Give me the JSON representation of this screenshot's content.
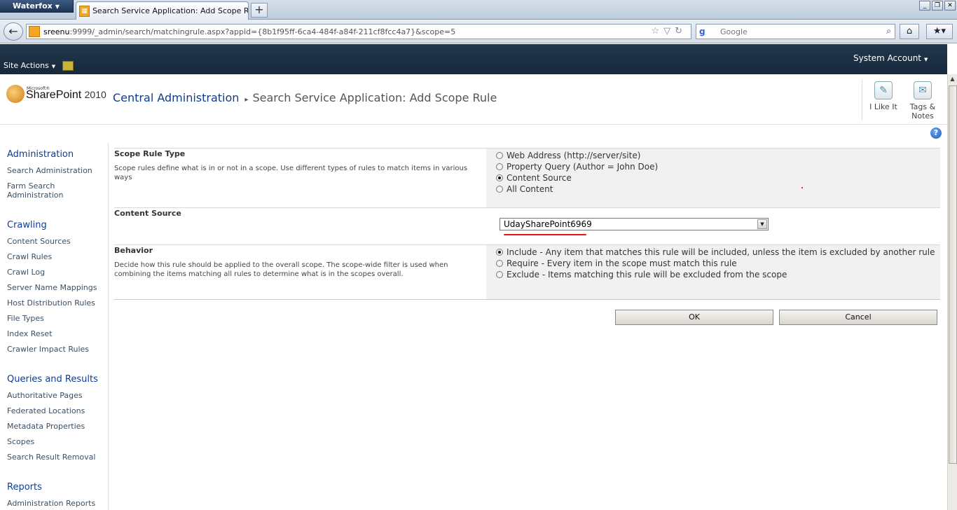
{
  "browser": {
    "app_menu": "Waterfox",
    "tab_title": "Search Service Application: Add Scope Rule",
    "new_tab": "+",
    "url_host": "sreenu",
    "url_rest": ":9999/_admin/search/matchingrule.aspx?appid={8b1f95ff-6ca4-484f-a84f-211cf8fcc4a7}&scope=5",
    "search_engine": "g",
    "search_placeholder": "Google",
    "window_controls": [
      "_",
      "❐",
      "✕"
    ]
  },
  "sp_top": {
    "site_actions": "Site Actions",
    "user": "System Account"
  },
  "title_area": {
    "logo_ms": "Microsoft®",
    "logo_name": "SharePoint",
    "logo_version": "2010",
    "breadcrumb_root": "Central Administration",
    "breadcrumb_sep": "▸",
    "breadcrumb_current": "Search Service Application: Add Scope Rule",
    "i_like_it": "I Like It",
    "tags_notes_1": "Tags &",
    "tags_notes_2": "Notes",
    "help": "?"
  },
  "quick_launch": {
    "administration": {
      "heading": "Administration",
      "items": [
        "Search Administration",
        "Farm Search",
        "Administration"
      ]
    },
    "crawling": {
      "heading": "Crawling",
      "items": [
        "Content Sources",
        "Crawl Rules",
        "Crawl Log",
        "Server Name Mappings",
        "Host Distribution Rules",
        "File Types",
        "Index Reset",
        "Crawler Impact Rules"
      ]
    },
    "queries": {
      "heading": "Queries and Results",
      "items": [
        "Authoritative Pages",
        "Federated Locations",
        "Metadata Properties",
        "Scopes",
        "Search Result Removal"
      ]
    },
    "reports": {
      "heading": "Reports",
      "items": [
        "Administration Reports"
      ]
    }
  },
  "form": {
    "scope_rule_type": {
      "title": "Scope Rule Type",
      "description": "Scope rules define what is in or not in a scope. Use different types of rules to match items in various ways",
      "options": [
        "Web Address (http://server/site)",
        "Property Query (Author = John Doe)",
        "Content Source",
        "All Content"
      ],
      "selected": "Content Source"
    },
    "content_source": {
      "title": "Content Source",
      "selected_value": "UdaySharePoint6969"
    },
    "behavior": {
      "title": "Behavior",
      "description": "Decide how this rule should be applied to the overall scope. The scope-wide filter is used when combining the items matching all rules to determine what is in the scopes overall.",
      "options": [
        "Include - Any item that matches this rule will be included, unless the item is excluded by another rule",
        "Require - Every item in the scope must match this rule",
        "Exclude - Items matching this rule will be excluded from the scope"
      ],
      "selected": "Include - Any item that matches this rule will be included, unless the item is excluded by another rule"
    },
    "ok_label": "OK",
    "cancel_label": "Cancel"
  }
}
